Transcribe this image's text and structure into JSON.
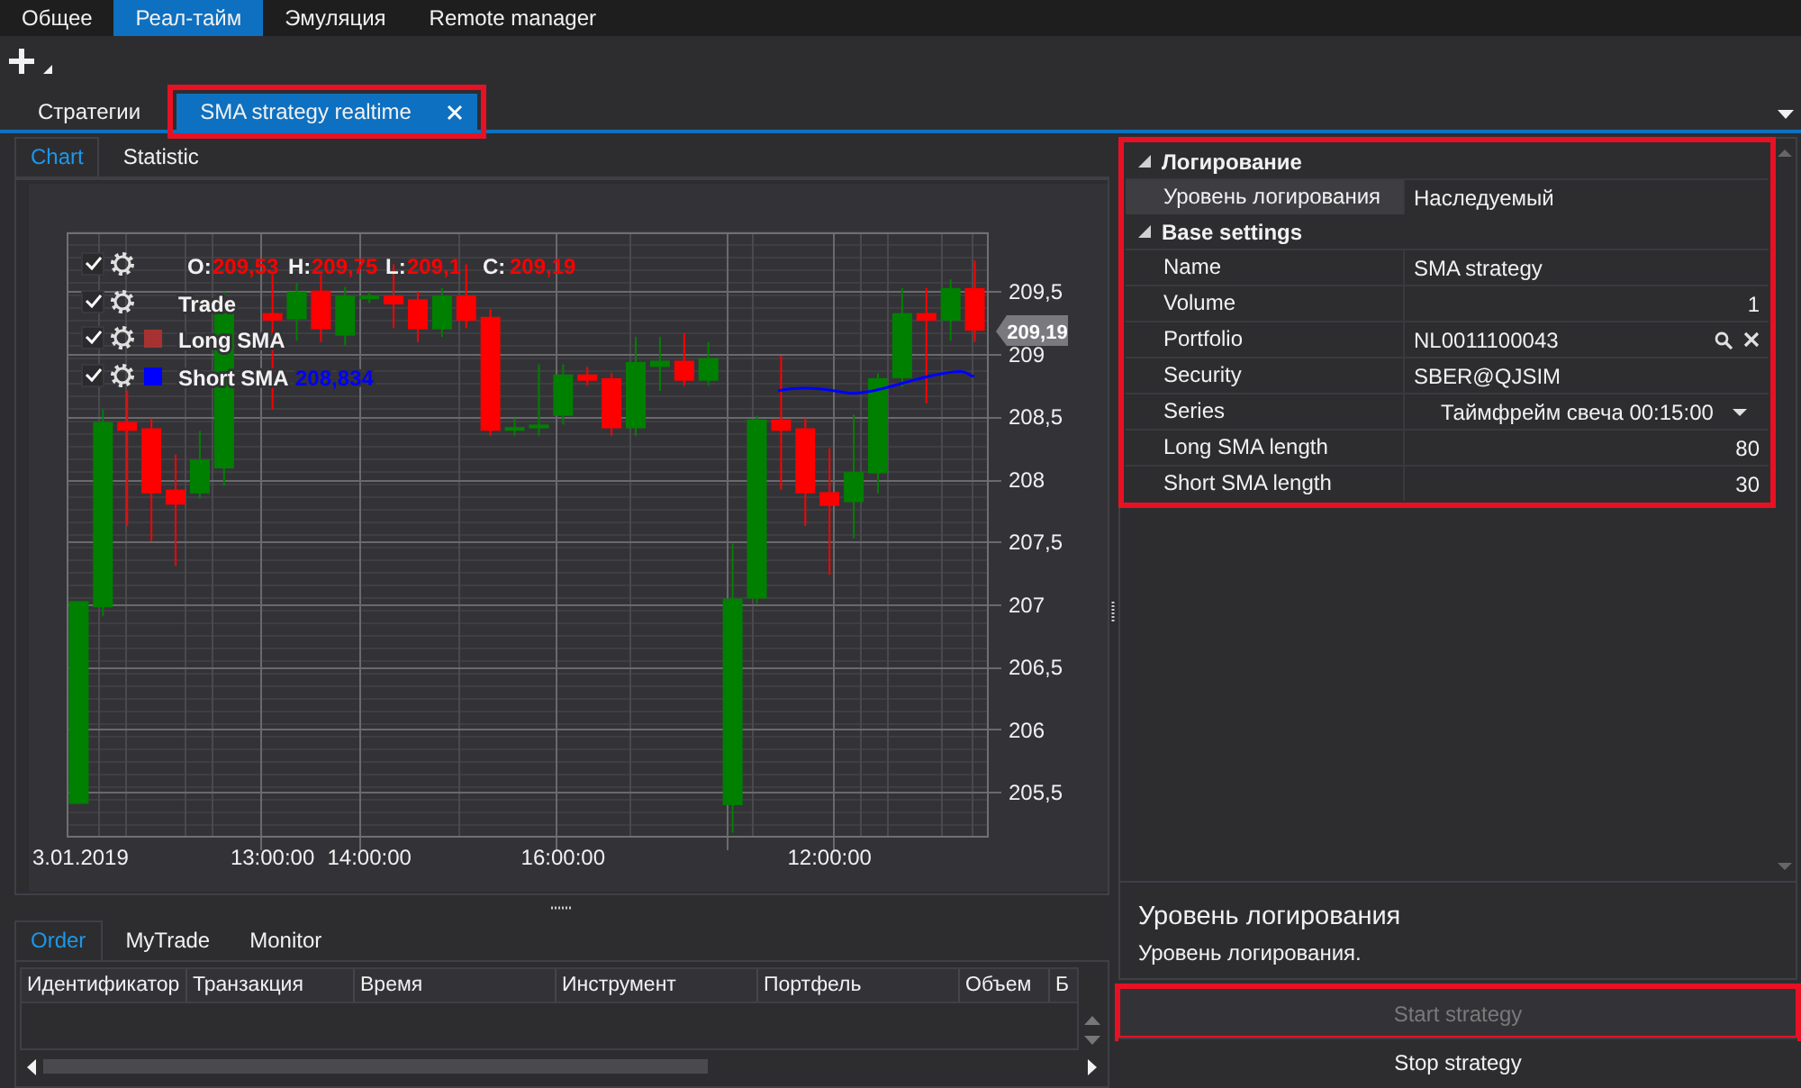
{
  "menu_tabs": [
    {
      "label": "Общее",
      "selected": false
    },
    {
      "label": "Реал-тайм",
      "selected": true
    },
    {
      "label": "Эмуляция",
      "selected": false
    },
    {
      "label": "Remote manager",
      "selected": false
    }
  ],
  "document_tabs": [
    {
      "label": "Стратегии",
      "selected": false,
      "closable": false,
      "highlighted": false
    },
    {
      "label": "SMA strategy realtime",
      "selected": true,
      "closable": true,
      "highlighted": true
    }
  ],
  "view_tabs": [
    {
      "label": "Chart",
      "selected": true
    },
    {
      "label": "Statistic",
      "selected": false
    }
  ],
  "chart": {
    "legend": [
      {
        "kind": "ohlc",
        "checked": true,
        "ohlc": [
          {
            "label": "O:",
            "value": "209,53"
          },
          {
            "label": "H:",
            "value": "209,75"
          },
          {
            "label": "L:",
            "value": "209,1"
          },
          {
            "label": "C:",
            "value": "209,19"
          }
        ]
      },
      {
        "kind": "series",
        "name": "Trade",
        "checked": true
      },
      {
        "kind": "series",
        "name": "Long SMA",
        "checked": true,
        "color": "#a83232"
      },
      {
        "kind": "series",
        "name": "Short SMA",
        "checked": true,
        "color": "#0000ff",
        "value": "208,834"
      }
    ],
    "chart_data": {
      "type": "candlestick",
      "categories": [
        "3.01.2019",
        null,
        null,
        null,
        null,
        null,
        null,
        null,
        "13:00:00",
        null,
        null,
        null,
        "14:00:00",
        null,
        null,
        null,
        null,
        null,
        null,
        null,
        "16:00:00",
        null,
        null,
        null,
        null,
        null,
        null,
        null,
        null,
        null,
        null,
        "12:00:00",
        null,
        null,
        null,
        null,
        null,
        null
      ],
      "ohlc": [
        [
          205.41,
          207.03,
          205.41,
          207.03
        ],
        [
          206.98,
          208.56,
          206.91,
          208.46
        ],
        [
          208.46,
          208.71,
          207.63,
          208.39
        ],
        [
          208.41,
          208.49,
          207.51,
          207.89
        ],
        [
          207.92,
          208.2,
          207.31,
          207.8
        ],
        [
          207.89,
          208.39,
          207.85,
          208.16
        ],
        [
          208.09,
          209.5,
          207.95,
          209.33
        ],
        null,
        [
          209.33,
          209.64,
          208.56,
          209.27
        ],
        [
          209.28,
          209.57,
          209.11,
          209.5
        ],
        [
          209.51,
          209.64,
          209.1,
          209.2
        ],
        [
          209.15,
          209.54,
          209.07,
          209.47
        ],
        [
          209.46,
          209.5,
          209.41,
          209.47
        ],
        [
          209.47,
          209.72,
          209.21,
          209.4
        ],
        [
          209.44,
          209.5,
          209.1,
          209.2
        ],
        [
          209.2,
          209.53,
          209.14,
          209.47
        ],
        [
          209.47,
          209.72,
          209.21,
          209.27
        ],
        [
          209.3,
          209.36,
          208.35,
          208.39
        ],
        [
          208.39,
          208.49,
          208.35,
          208.42
        ],
        [
          208.41,
          208.92,
          208.35,
          208.44
        ],
        [
          208.51,
          208.92,
          208.44,
          208.84
        ],
        [
          208.84,
          208.9,
          208.75,
          208.79
        ],
        [
          208.81,
          208.85,
          208.35,
          208.41
        ],
        [
          208.41,
          209.14,
          208.35,
          208.94
        ],
        [
          208.9,
          209.14,
          208.71,
          208.95
        ],
        [
          208.95,
          209.17,
          208.75,
          208.79
        ],
        [
          208.79,
          209.1,
          208.75,
          208.97
        ],
        [
          205.4,
          207.49,
          205.18,
          207.05
        ],
        [
          207.05,
          208.51,
          207.01,
          208.48
        ],
        [
          208.48,
          208.99,
          207.92,
          208.39
        ],
        [
          208.41,
          208.49,
          207.63,
          207.89
        ],
        [
          207.9,
          208.25,
          207.24,
          207.79
        ],
        [
          207.82,
          208.52,
          207.53,
          208.06
        ],
        [
          208.05,
          208.85,
          207.89,
          208.81
        ],
        [
          208.81,
          209.53,
          208.74,
          209.33
        ],
        [
          209.33,
          209.53,
          208.61,
          209.27
        ],
        [
          209.27,
          209.6,
          209.11,
          209.53
        ],
        [
          209.53,
          209.75,
          209.1,
          209.19
        ]
      ],
      "grid": true,
      "ylim": [
        205.155,
        209.975
      ],
      "yticks": [
        {
          "value": 209.5,
          "label": "209,5"
        },
        {
          "value": 209,
          "label": "209"
        },
        {
          "value": 208.5,
          "label": "208,5"
        },
        {
          "value": 208,
          "label": "208"
        },
        {
          "value": 207.5,
          "label": "207,5"
        },
        {
          "value": 207,
          "label": "207"
        },
        {
          "value": 206.5,
          "label": "206,5"
        },
        {
          "value": 206,
          "label": "206"
        },
        {
          "value": 205.5,
          "label": "205,5"
        }
      ]
    },
    "last_price": "209,19"
  },
  "bottom_tabs": [
    {
      "label": "Order",
      "selected": true
    },
    {
      "label": "MyTrade",
      "selected": false
    },
    {
      "label": "Monitor",
      "selected": false
    }
  ],
  "orders_table": {
    "columns": [
      "Идентификатор",
      "Транзакция",
      "Время",
      "Инструмент",
      "Портфель",
      "Объем",
      "Б"
    ]
  },
  "properties": {
    "highlighted": true,
    "categories": [
      {
        "title": "Логирование",
        "expanded": true,
        "items": [
          {
            "name": "Уровень логирования",
            "value": "Наследуемый",
            "kind": "text",
            "selected": true
          }
        ]
      },
      {
        "title": "Base settings",
        "expanded": true,
        "items": [
          {
            "name": "Name",
            "value": "SMA strategy",
            "kind": "text",
            "selected": false
          },
          {
            "name": "Volume",
            "value": "1",
            "kind": "number",
            "selected": false
          },
          {
            "name": "Portfolio",
            "value": "NL0011100043",
            "kind": "lookup",
            "selected": false
          },
          {
            "name": "Security",
            "value": "SBER@QJSIM",
            "kind": "text",
            "selected": false
          },
          {
            "name": "Series",
            "value": "Таймфрейм свеча 00:15:00",
            "kind": "dropdown",
            "selected": false
          },
          {
            "name": "Long SMA length",
            "value": "80",
            "kind": "number",
            "selected": false
          },
          {
            "name": "Short SMA length",
            "value": "30",
            "kind": "number",
            "selected": false
          }
        ]
      }
    ]
  },
  "description": {
    "title": "Уровень логирования",
    "text": "Уровень логирования."
  },
  "actions": [
    {
      "label": "Start strategy",
      "disabled": true,
      "highlighted": true
    },
    {
      "label": "Stop strategy",
      "disabled": false,
      "highlighted": false
    }
  ]
}
